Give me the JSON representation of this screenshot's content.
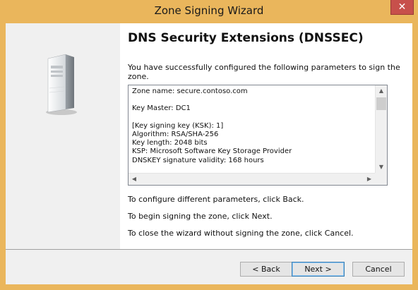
{
  "window": {
    "title": "Zone Signing Wizard",
    "close_glyph": "✕"
  },
  "page": {
    "heading": "DNS Security Extensions (DNSSEC)",
    "intro": "You have successfully configured the following parameters to sign the zone."
  },
  "summary": {
    "lines": [
      "Zone name: secure.contoso.com",
      "",
      "Key Master: DC1",
      "",
      "[Key signing key (KSK): 1]",
      "Algorithm: RSA/SHA-256",
      "Key length: 2048 bits",
      "KSP: Microsoft Software Key Storage Provider",
      "DNSKEY signature validity: 168 hours"
    ],
    "scroll_up_glyph": "▲",
    "scroll_down_glyph": "▼",
    "scroll_left_glyph": "◀",
    "scroll_right_glyph": "▶"
  },
  "instructions": {
    "back": "To configure different parameters, click Back.",
    "next": "To begin signing the zone, click Next.",
    "cancel": "To close the wizard without signing the zone, click Cancel."
  },
  "buttons": {
    "back": "< Back",
    "next": "Next >",
    "cancel": "Cancel"
  },
  "icons": {
    "server": "server-tower-icon"
  },
  "colors": {
    "title_bar": "#eab65c",
    "close_button": "#c7504b",
    "default_button_border": "#3c7fb1"
  }
}
